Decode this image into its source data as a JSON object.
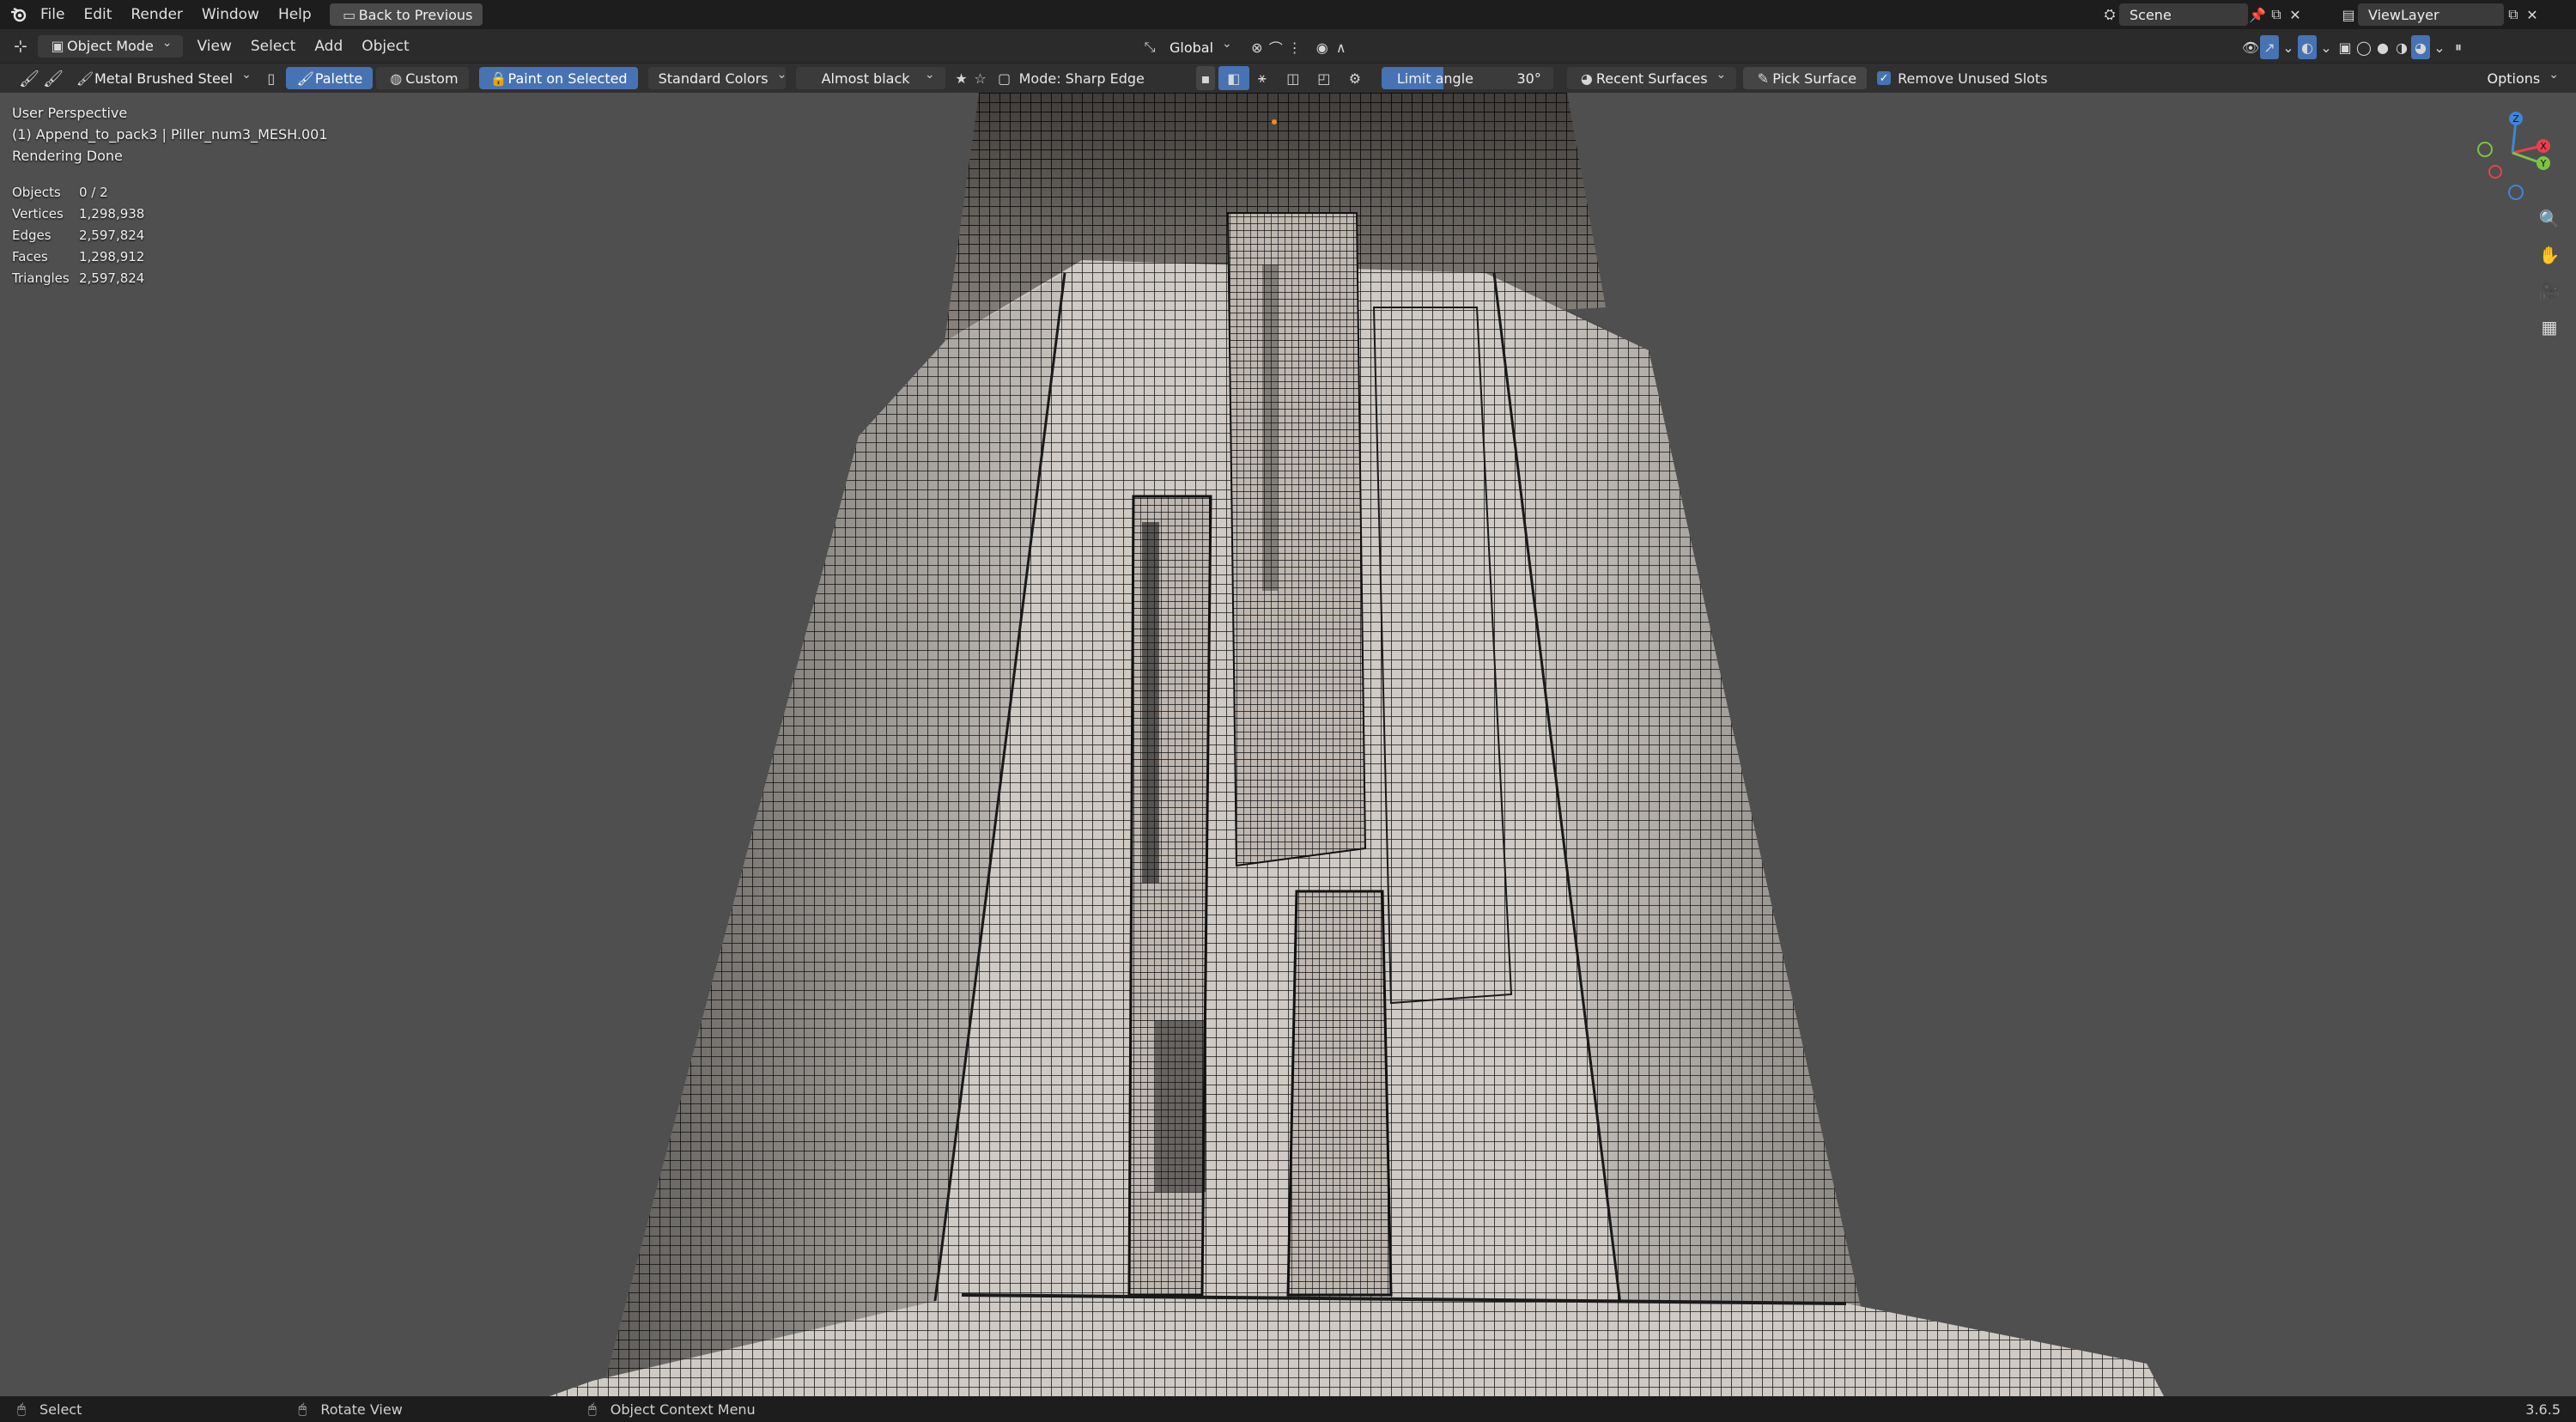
{
  "topbar": {
    "logo_icon": "blender-logo-icon",
    "menus": [
      "File",
      "Edit",
      "Render",
      "Window",
      "Help"
    ],
    "back_button": "Back to Previous",
    "scene": "Scene",
    "view_layer": "ViewLayer"
  },
  "header": {
    "mode": "Object Mode",
    "menus": [
      "View",
      "Select",
      "Add",
      "Object"
    ],
    "orientation": "Global"
  },
  "toolbar": {
    "material": "Metal Brushed Steel",
    "palette": "Palette",
    "custom": "Custom",
    "paint_on_selected": "Paint on Selected",
    "standard_colors": "Standard Colors",
    "color": "Almost black",
    "mode": "Mode: Sharp Edge",
    "limit_angle_label": "Limit angle",
    "limit_angle_value": "30°",
    "recent_surfaces": "Recent Surfaces",
    "pick_surface": "Pick Surface",
    "remove_unused": "Remove Unused Slots",
    "options": "Options"
  },
  "viewport": {
    "perspective": "User Perspective",
    "object_path": "(1) Append_to_pack3 | Piller_num3_MESH.001",
    "render_status": "Rendering Done",
    "stats": [
      {
        "label": "Objects",
        "value": "0 / 2"
      },
      {
        "label": "Vertices",
        "value": "1,298,938"
      },
      {
        "label": "Edges",
        "value": "2,597,824"
      },
      {
        "label": "Faces",
        "value": "1,298,912"
      },
      {
        "label": "Triangles",
        "value": "2,597,824"
      }
    ],
    "gizmo": {
      "x": "X",
      "y": "Y",
      "z": "Z"
    }
  },
  "statusbar": {
    "select": "Select",
    "rotate": "Rotate View",
    "context": "Object Context Menu",
    "version": "3.6.5"
  },
  "colors": {
    "accent": "#4772b3",
    "viewport_bg": "#4f4f4f",
    "axis_x": "#e8404f",
    "axis_y": "#7cc443",
    "axis_z": "#3e86d8"
  }
}
